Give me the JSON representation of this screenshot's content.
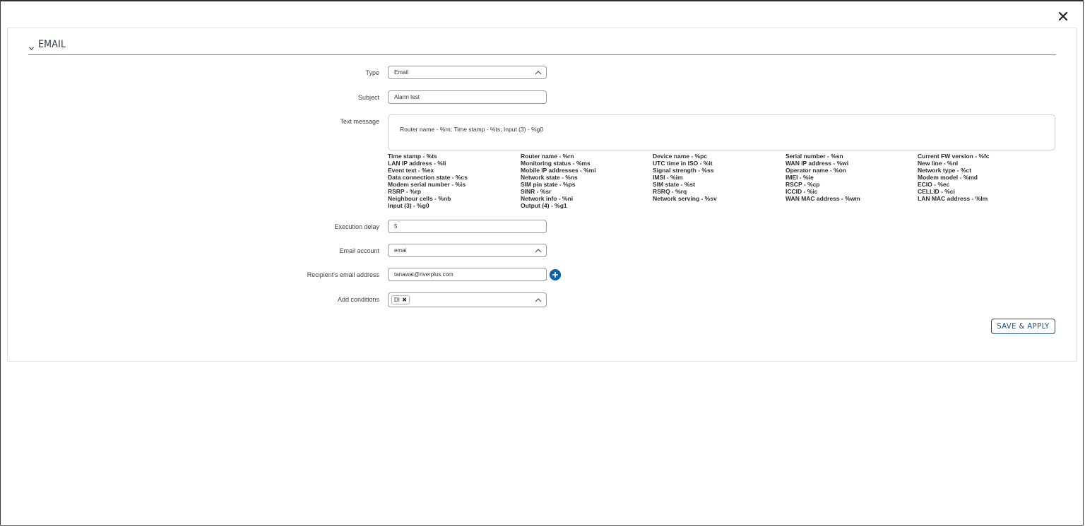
{
  "dialog": {
    "close_icon": "close-icon"
  },
  "section": {
    "title": "EMAIL",
    "collapse_icon": "chevron-down-icon"
  },
  "form": {
    "type": {
      "label": "Type",
      "value": "Email"
    },
    "subject": {
      "label": "Subject",
      "value": "Alarm test"
    },
    "text_message": {
      "label": "Text message",
      "value": "Router name - %rn; Time stamp - %ts; Input (3) - %g0"
    },
    "variables": [
      [
        "Time stamp - %ts",
        "LAN IP address - %li",
        "Event text - %ex",
        "Data connection state - %cs",
        "Modem serial number - %is",
        "RSRP - %rp",
        "Neighbour cells - %nb",
        "Input (3) - %g0"
      ],
      [
        "Router name - %rn",
        "Monitoring status - %ms",
        "Mobile IP addresses - %mi",
        "Network state - %ns",
        "SIM pin state - %ps",
        "SINR - %sr",
        "Network info - %ni",
        "Output (4) - %g1"
      ],
      [
        "Device name - %pc",
        "UTC time in ISO - %it",
        "Signal strength - %ss",
        "IMSI - %im",
        "SIM state - %st",
        "RSRQ - %rq",
        "Network serving - %sv"
      ],
      [
        "Serial number - %sn",
        "WAN IP address - %wi",
        "Operator name - %on",
        "IMEI - %ie",
        "RSCP - %cp",
        "ICCID - %ic",
        "WAN MAC address - %wm"
      ],
      [
        "Current FW version - %fc",
        "New line - %nl",
        "Network type - %ct",
        "Modem model - %md",
        "ECIO - %ec",
        "CELLID - %ci",
        "LAN MAC address - %lm"
      ]
    ],
    "execution_delay": {
      "label": "Execution delay",
      "value": "5"
    },
    "email_account": {
      "label": "Email account",
      "value": "emai"
    },
    "recipient": {
      "label": "Recipient's email address",
      "value": "tanawat@riverplus.com"
    },
    "conditions": {
      "label": "Add conditions",
      "tag": "DI"
    }
  },
  "actions": {
    "save_label": "SAVE & APPLY"
  },
  "colors": {
    "accent": "#0d5fa6",
    "button_border": "#1f4d7a"
  }
}
